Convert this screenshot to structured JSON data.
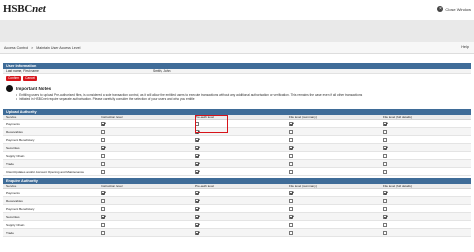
{
  "header": {
    "logo_main": "HSBC",
    "logo_italic": "net",
    "close_label": "Close Window",
    "close_glyph": "×"
  },
  "breadcrumb": {
    "items": [
      "Access Control",
      ">",
      "Maintain User Access Level"
    ]
  },
  "help_label": "Help",
  "user_info": {
    "heading": "User Information",
    "field_label": "Last name, First name",
    "field_value": "Smith, John"
  },
  "actions": {
    "confirm": "Confirm",
    "cancel": "Cancel"
  },
  "notes": {
    "title": "Important Notes",
    "items": [
      "Entitling users to upload Pre-authorised files, is considered a sole transaction control, as it will allow the entitled users to execute transactions without any additional authorisation or verification. This remains the case even if all other transactions",
      "initiated in HSBCnet require separate authorisation. Please carefully consider the selection of your users and who you entitle"
    ]
  },
  "upload_authority": {
    "heading": "Upload Authority",
    "columns": [
      "Service",
      "Instruction level",
      "Pre-auth level",
      "File level (summary)",
      "File level (full details)"
    ],
    "rows": [
      {
        "service": "Payments",
        "checks": [
          true,
          false,
          true,
          true
        ]
      },
      {
        "service": "Receivables",
        "checks": [
          false,
          true,
          false,
          false
        ]
      },
      {
        "service": "Payment Beneficiary",
        "checks": [
          false,
          true,
          false,
          false
        ]
      },
      {
        "service": "Securities",
        "checks": [
          true,
          true,
          true,
          true
        ]
      },
      {
        "service": "Supply Chain",
        "checks": [
          false,
          true,
          false,
          false
        ]
      },
      {
        "service": "Trade",
        "checks": [
          false,
          true,
          false,
          false
        ]
      },
      {
        "service": "ClientUpdates and/or Account Opening and Maintenance",
        "checks": [
          false,
          true,
          false,
          false
        ]
      }
    ]
  },
  "enquire_authority": {
    "heading": "Enquire Authority",
    "columns": [
      "Service",
      "Instruction level",
      "Pre-auth level",
      "File level (summary)",
      "File level (full details)"
    ],
    "rows": [
      {
        "service": "Payments",
        "checks": [
          true,
          true,
          true,
          true
        ]
      },
      {
        "service": "Receivables",
        "checks": [
          false,
          true,
          false,
          false
        ]
      },
      {
        "service": "Payment Beneficiary",
        "checks": [
          false,
          true,
          false,
          false
        ]
      },
      {
        "service": "Securities",
        "checks": [
          true,
          true,
          true,
          true
        ]
      },
      {
        "service": "Supply Chain",
        "checks": [
          false,
          true,
          false,
          false
        ]
      },
      {
        "service": "Trade",
        "checks": [
          false,
          true,
          false,
          false
        ]
      }
    ]
  },
  "colors": {
    "section_header": "#3f6c98",
    "accent_red": "#d7141a"
  }
}
